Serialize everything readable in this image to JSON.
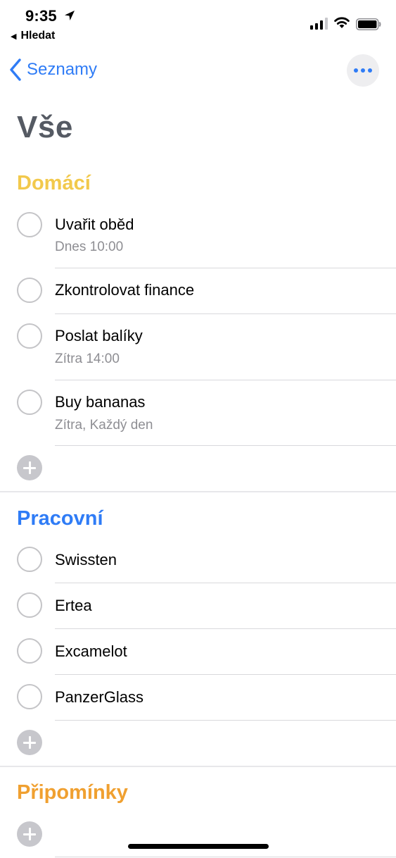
{
  "status_bar": {
    "time": "9:35",
    "back_app_label": "Hledat"
  },
  "nav": {
    "back_label": "Seznamy"
  },
  "page": {
    "title": "Vše"
  },
  "colors": {
    "accent_blue": "#2f7cf6",
    "domaci_yellow": "#f2c94c",
    "pracovni_blue": "#2f7cf6",
    "pripominky_orange": "#f0a030",
    "title_gray": "#555a63"
  },
  "sections": [
    {
      "title": "Domácí",
      "tasks": [
        {
          "title": "Uvařit oběd",
          "subtitle": "Dnes 10:00"
        },
        {
          "title": "Zkontrolovat finance"
        },
        {
          "title": "Poslat balíky",
          "subtitle": "Zítra 14:00"
        },
        {
          "title": "Buy bananas",
          "subtitle": "Zítra, Každý den"
        }
      ]
    },
    {
      "title": "Pracovní",
      "tasks": [
        {
          "title": "Swissten"
        },
        {
          "title": "Ertea"
        },
        {
          "title": "Excamelot"
        },
        {
          "title": "PanzerGlass"
        }
      ]
    },
    {
      "title": "Připomínky",
      "tasks": []
    }
  ],
  "icons": {
    "location": "location-arrow-icon",
    "signal": "cellular-signal-icon",
    "wifi": "wifi-icon",
    "battery": "battery-icon",
    "back": "chevron-left-icon",
    "more": "ellipsis-icon",
    "add": "plus-circle-icon",
    "check": "empty-circle-icon"
  }
}
